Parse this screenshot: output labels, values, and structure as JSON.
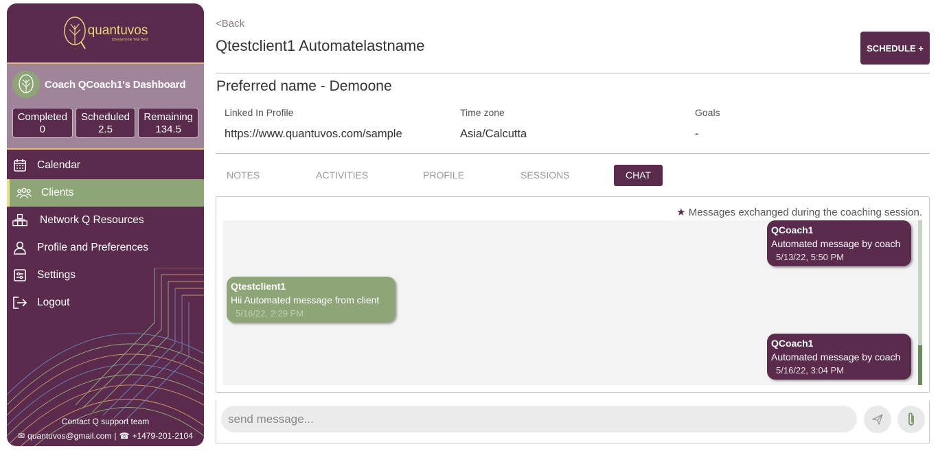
{
  "sidebar": {
    "logo_text": "quantuvos",
    "logo_tagline": "Choose to be Your Best",
    "coach_title": "Coach QCoach1's Dashboard",
    "stats": [
      {
        "label": "Completed",
        "value": "0"
      },
      {
        "label": "Scheduled",
        "value": "2.5"
      },
      {
        "label": "Remaining",
        "value": "134.5"
      }
    ],
    "nav": [
      {
        "label": "Calendar",
        "icon": "calendar-icon"
      },
      {
        "label": "Clients",
        "icon": "users-icon",
        "active": true
      },
      {
        "label": "Network Q Resources",
        "icon": "network-icon"
      },
      {
        "label": "Profile and Preferences",
        "icon": "user-icon"
      },
      {
        "label": "Settings",
        "icon": "settings-icon"
      },
      {
        "label": "Logout",
        "icon": "logout-icon"
      }
    ],
    "contact_title": "Contact Q support team",
    "contact_email": "quantuvos@gmail.com",
    "contact_phone": "+1479-201-2104"
  },
  "header": {
    "back_label": "<Back",
    "client_name": "Qtestclient1 Automatelastname",
    "schedule_label": "SCHEDULE +"
  },
  "profile": {
    "preferred_name": "Preferred name  - Demoone",
    "linkedin_label": "Linked In Profile",
    "linkedin_value": "https://www.quantuvos.com/sample",
    "timezone_label": "Time zone",
    "timezone_value": "Asia/Calcutta",
    "goals_label": "Goals",
    "goals_value": "-"
  },
  "tabs": [
    {
      "label": "NOTES"
    },
    {
      "label": "ACTIVITIES"
    },
    {
      "label": "PROFILE"
    },
    {
      "label": "SESSIONS"
    },
    {
      "label": "CHAT",
      "active": true
    }
  ],
  "chat": {
    "legend": "Messages exchanged during the coaching session.",
    "messages": [
      {
        "sender": "QCoach1",
        "text": "Automated message by coach",
        "time": "5/13/22, 5:50 PM",
        "role": "coach"
      },
      {
        "sender": "Qtestclient1",
        "text": "Hii Automated message from client",
        "time": "5/16/22, 2:29 PM",
        "role": "client"
      },
      {
        "sender": "QCoach1",
        "text": "Automated message by coach",
        "time": "5/16/22, 3:04 PM",
        "role": "coach"
      }
    ],
    "input_placeholder": "send message..."
  },
  "colors": {
    "brand": "#5a2b4c",
    "accent_green": "#8ea578",
    "accent_gold": "#e6b98a"
  }
}
